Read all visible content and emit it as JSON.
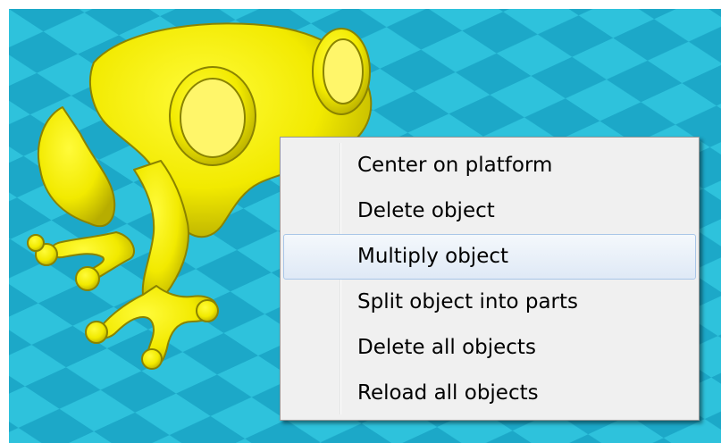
{
  "viewport": {
    "floor_colors": [
      "#2ec2dc",
      "#1aa6c6"
    ],
    "model_color": "#f2ea00",
    "model_outline": "#8a8300"
  },
  "context_menu": {
    "items": [
      {
        "label": "Center on platform",
        "highlighted": false
      },
      {
        "label": "Delete object",
        "highlighted": false
      },
      {
        "label": "Multiply object",
        "highlighted": true
      },
      {
        "label": "Split object into parts",
        "highlighted": false
      },
      {
        "label": "Delete all objects",
        "highlighted": false
      },
      {
        "label": "Reload all objects",
        "highlighted": false
      }
    ]
  }
}
